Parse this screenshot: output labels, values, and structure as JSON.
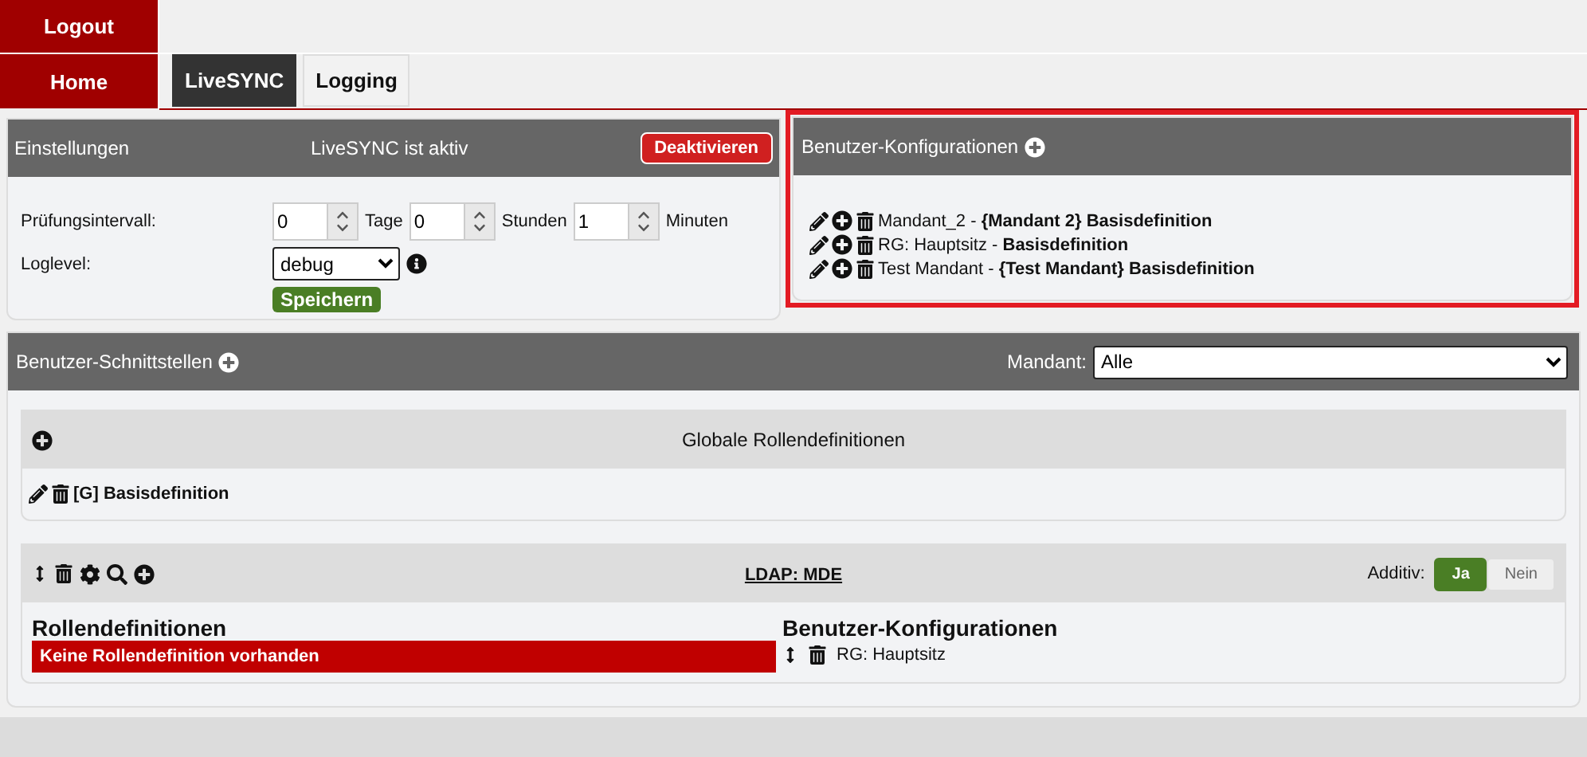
{
  "nav": [
    {
      "label": "Logout"
    },
    {
      "label": "Home"
    }
  ],
  "tabs": [
    {
      "label": "LiveSYNC",
      "selected": true
    },
    {
      "label": "Logging",
      "selected": false
    }
  ],
  "settings": {
    "title": "Einstellungen",
    "status": "LiveSYNC ist aktiv",
    "deactivate": "Deaktivieren",
    "interval_label": "Prüfungsintervall:",
    "interval": [
      {
        "value": "0",
        "unit": "Tage"
      },
      {
        "value": "0",
        "unit": "Stunden"
      },
      {
        "value": "1",
        "unit": "Minuten"
      }
    ],
    "loglevel_label": "Loglevel:",
    "loglevel": "debug",
    "save": "Speichern"
  },
  "user_configs": {
    "title": "Benutzer-Konfigurationen",
    "highlighted": true,
    "items": [
      {
        "text": "Mandant_2 - **{Mandant 2} Basisdefinition**"
      },
      {
        "text": "RG: Hauptsitz - **Basisdefinition**"
      },
      {
        "text": "Test Mandant - **{Test Mandant} Basisdefinition**"
      }
    ]
  },
  "interfaces": {
    "title": "Benutzer-Schnittstellen",
    "mandant_label": "Mandant:",
    "mandant": "Alle",
    "global_roles": {
      "title": "Globale Rollendefinitionen",
      "items": [
        {
          "text": "[G] Basisdefinition"
        }
      ]
    },
    "ldap": {
      "title": "LDAP: MDE",
      "additive_label": "Additiv:",
      "options": [
        {
          "label": "Ja",
          "selected": true
        },
        {
          "label": "Nein",
          "selected": false
        }
      ],
      "roles_title": "Rollendefinitionen",
      "roles_empty": "Keine Rollendefinition vorhanden",
      "configs_title": "Benutzer-Konfigurationen",
      "configs": [
        {
          "text": "RG: Hauptsitz"
        }
      ]
    }
  }
}
